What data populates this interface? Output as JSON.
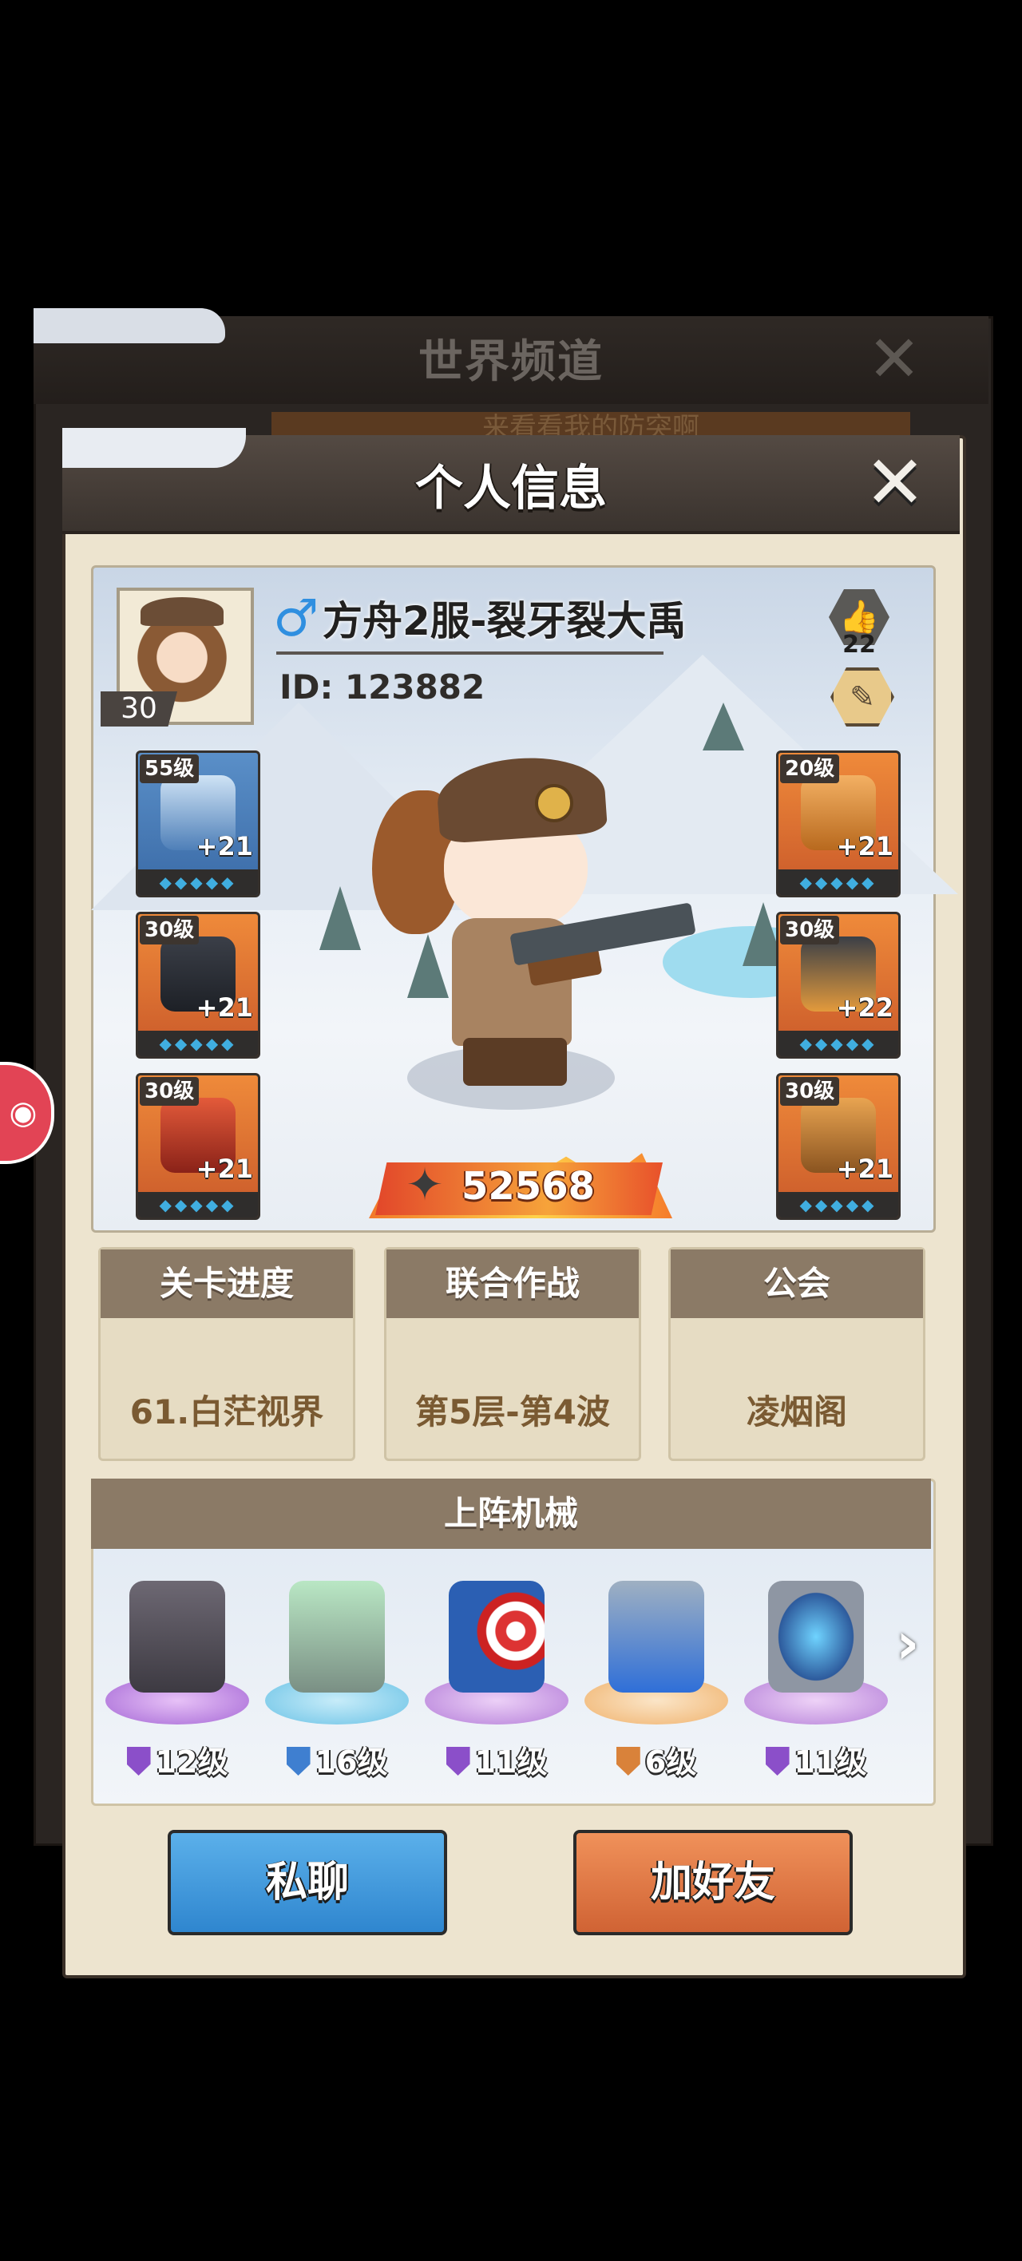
{
  "background_window": {
    "title": "世界频道",
    "close_icon": "close-icon",
    "message_preview": "来看看我的防突啊"
  },
  "dialog": {
    "title": "个人信息",
    "close_icon": "close-icon"
  },
  "profile": {
    "avatar_level": "30",
    "gender_icon": "male-icon",
    "gender_symbol": "♂",
    "name": "方舟2服-裂牙裂大禹",
    "id_label": "ID: 123882",
    "likes": "22",
    "power": "52568"
  },
  "equipment": {
    "left": [
      {
        "level": "55级",
        "plus": "+21",
        "gems": "◆◆◆◆◆"
      },
      {
        "level": "30级",
        "plus": "+21",
        "gems": "◆◆◆◆◆"
      },
      {
        "level": "30级",
        "plus": "+21",
        "gems": "◆◆◆◆◆"
      }
    ],
    "right": [
      {
        "level": "20级",
        "plus": "+21",
        "gems": "◆◆◆◆◆"
      },
      {
        "level": "30级",
        "plus": "+22",
        "gems": "◆◆◆◆◆"
      },
      {
        "level": "30级",
        "plus": "+21",
        "gems": "◆◆◆◆◆"
      }
    ]
  },
  "stats": [
    {
      "label": "关卡进度",
      "value": "61.白茫视界"
    },
    {
      "label": "联合作战",
      "value": "第5层-第4波"
    },
    {
      "label": "公会",
      "value": "凌烟阁"
    }
  ],
  "mechs": {
    "title": "上阵机械",
    "items": [
      {
        "level": "12级",
        "color": "#8b4fc9"
      },
      {
        "level": "16级",
        "color": "#3f7fd0"
      },
      {
        "level": "11级",
        "color": "#8b4fc9"
      },
      {
        "level": "6级",
        "color": "#d9823a"
      },
      {
        "level": "11级",
        "color": "#8b4fc9"
      }
    ],
    "next_icon": "chevron-right-icon"
  },
  "buttons": {
    "chat": "私聊",
    "add_friend": "加好友"
  },
  "colors": {
    "chat_button": "#3b93d8",
    "friend_button": "#dd7040",
    "header": "#4a413b",
    "panel": "#ede4cf"
  }
}
